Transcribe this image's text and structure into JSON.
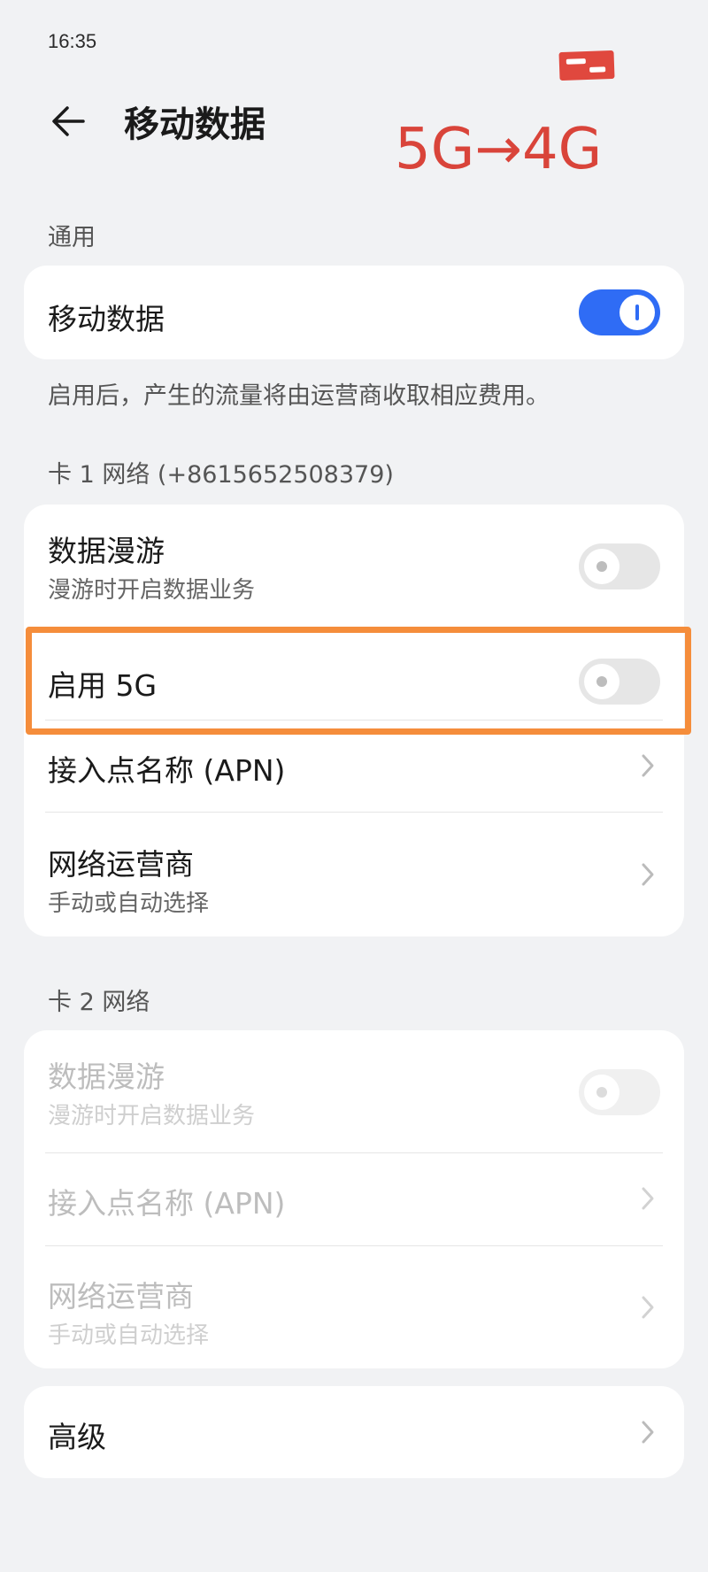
{
  "status_bar": {
    "time": "16:35"
  },
  "header": {
    "title": "移动数据",
    "back_icon": "back-arrow-icon"
  },
  "annotation_text": "5G→4G",
  "general": {
    "section_label": "通用",
    "mobile_data": {
      "label": "移动数据",
      "enabled": true
    },
    "note": "启用后，产生的流量将由运营商收取相应费用。"
  },
  "card1": {
    "section_label": "卡 1 网络 (+8615652508379)",
    "data_roaming": {
      "label": "数据漫游",
      "sub": "漫游时开启数据业务",
      "enabled": false
    },
    "enable_5g": {
      "label": "启用 5G",
      "enabled": false
    },
    "apn": {
      "label": "接入点名称 (APN)"
    },
    "carrier": {
      "label": "网络运营商",
      "sub": "手动或自动选择"
    }
  },
  "card2": {
    "section_label": "卡 2 网络",
    "data_roaming": {
      "label": "数据漫游",
      "sub": "漫游时开启数据业务",
      "enabled": false,
      "disabled": true
    },
    "apn": {
      "label": "接入点名称 (APN)",
      "disabled": true
    },
    "carrier": {
      "label": "网络运营商",
      "sub": "手动或自动选择",
      "disabled": true
    }
  },
  "advanced": {
    "label": "高级"
  },
  "colors": {
    "toggle_on": "#2f6cf5",
    "annotation": "#d9443a",
    "highlight": "#f58d3b"
  }
}
